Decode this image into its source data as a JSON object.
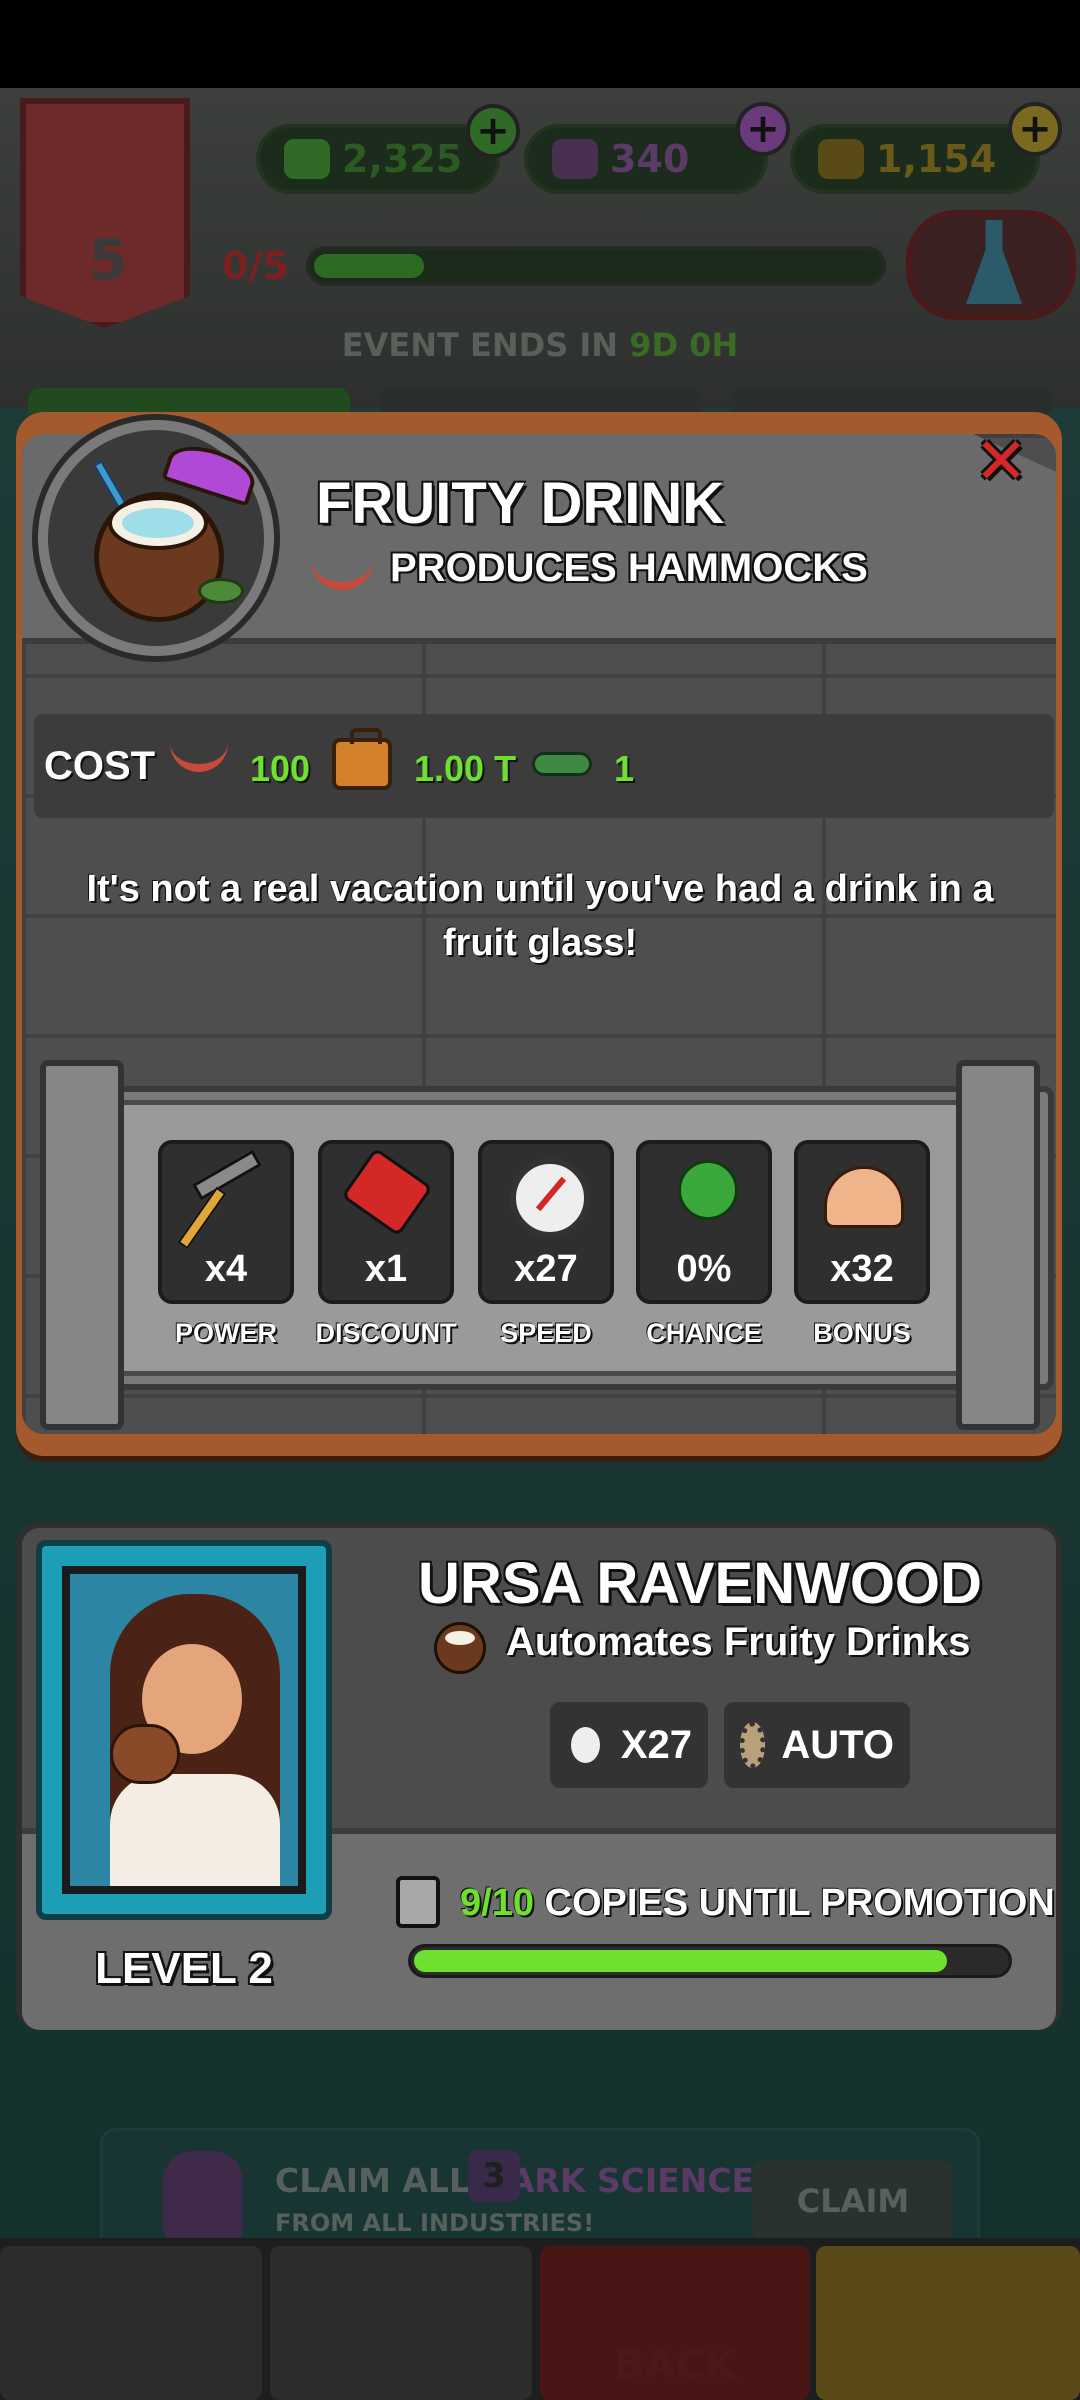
{
  "background": {
    "level": "5",
    "currencies": [
      {
        "name": "cash",
        "value": "2,325",
        "color": "#2f6a26"
      },
      {
        "name": "dark-science",
        "value": "340",
        "color": "#6a3a7a"
      },
      {
        "name": "gold",
        "value": "1,154",
        "color": "#7a6a20"
      }
    ],
    "progress_label": "0/5",
    "event": {
      "label": "EVENT ENDS IN",
      "time": "9D 0H"
    },
    "claim": {
      "prefix": "CLAIM ALL",
      "highlight": "DARK SCIENCE",
      "suffix": "FROM ALL INDUSTRIES!",
      "button": "CLAIM"
    },
    "nav": {
      "badge": "3",
      "back_label": "BACK"
    }
  },
  "modal": {
    "title": "FRUITY DRINK",
    "produces": "PRODUCES HAMMOCKS",
    "close_icon": "close-icon",
    "cost": {
      "label": "COST",
      "items": [
        {
          "icon": "hammock-icon",
          "value": "100"
        },
        {
          "icon": "suitcase-icon",
          "value": "1.00 T"
        },
        {
          "icon": "slippers-icon",
          "value": "1"
        }
      ]
    },
    "flavor_text": "It's not a real vacation until you've had a drink in a fruit glass!",
    "stats": [
      {
        "label": "POWER",
        "value": "x4",
        "icon": "hammer-icon"
      },
      {
        "label": "DISCOUNT",
        "value": "x1",
        "icon": "price-tag-icon"
      },
      {
        "label": "SPEED",
        "value": "x27",
        "icon": "speedometer-icon"
      },
      {
        "label": "CHANCE",
        "value": "0%",
        "icon": "clover-icon"
      },
      {
        "label": "BONUS",
        "value": "x32",
        "icon": "bicep-icon"
      }
    ]
  },
  "manager": {
    "name": "URSA RAVENWOOD",
    "ability": "Automates Fruity Drinks",
    "level": "LEVEL 2",
    "chips": [
      {
        "icon": "speedometer-icon",
        "label": "X27"
      },
      {
        "icon": "gear-icon",
        "label": "AUTO"
      }
    ],
    "copies_current": "9/10",
    "copies_label": "COPIES UNTIL PROMOTION",
    "promotion_progress": 0.9
  },
  "colors": {
    "accent_green": "#6ee12e",
    "close_red": "#d42828",
    "frame_orange": "#a45a2c",
    "portrait_teal": "#1e9fb8"
  }
}
